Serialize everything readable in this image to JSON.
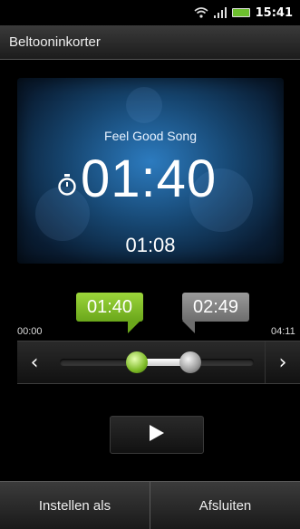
{
  "status_bar": {
    "time": "15:41",
    "icons": [
      "wifi-icon",
      "signal-icon",
      "battery-icon"
    ]
  },
  "title_bar": {
    "title": "Beltooninkorter"
  },
  "player": {
    "song_title": "Feel Good Song",
    "current_position": "01:40",
    "elapsed": "01:08",
    "icon": "stopwatch-icon"
  },
  "trim": {
    "start_label": "01:40",
    "end_label": "02:49",
    "range_min": "00:00",
    "range_max": "04:11",
    "start_fraction": 0.398,
    "end_fraction": 0.673,
    "left_arrow": "‹",
    "right_arrow": "›"
  },
  "controls": {
    "play_icon": "play-icon"
  },
  "bottom_bar": {
    "set_as_label": "Instellen als",
    "close_label": "Afsluiten"
  },
  "colors": {
    "accent_green": "#7dba26",
    "marker_gray": "#7a7a7a",
    "player_blue": "#1e5a90"
  }
}
